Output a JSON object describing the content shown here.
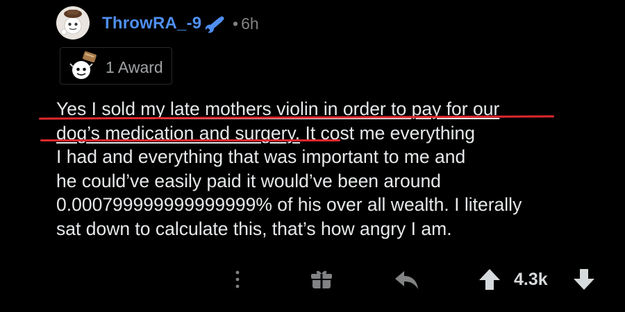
{
  "comment": {
    "author": "ThrowRA_-9",
    "separator": "•",
    "time": "6h",
    "award_text": "1 Award",
    "body_lines": [
      {
        "underlined": "Yes I sold my late mothers violin in order to pay for our",
        "rest": ""
      },
      {
        "underlined": "dog’s medication and surgery.",
        "rest": " It cost me everything"
      },
      {
        "underlined": "",
        "rest": "I had and everything that was important to me and"
      },
      {
        "underlined": "",
        "rest": "he could’ve easily paid it would’ve been around"
      },
      {
        "underlined": "",
        "rest": "0.000799999999999999% of his over all wealth. I literally"
      },
      {
        "underlined": "",
        "rest": "sat down to calculate this, that’s how angry I am."
      }
    ],
    "score": "4.3k"
  },
  "icons": {
    "avatar": "snoo-avatar-icon",
    "mod": "wrench-icon",
    "award": "award-icon",
    "more": "more-vertical-icon",
    "gift": "gift-icon",
    "reply": "reply-icon",
    "upvote": "arrow-up-icon",
    "downvote": "arrow-down-icon"
  },
  "colors": {
    "background": "#000000",
    "username": "#4f8ff0",
    "text": "#e6e8ea",
    "muted": "#818384",
    "highlight_mark": "#e0282e"
  }
}
